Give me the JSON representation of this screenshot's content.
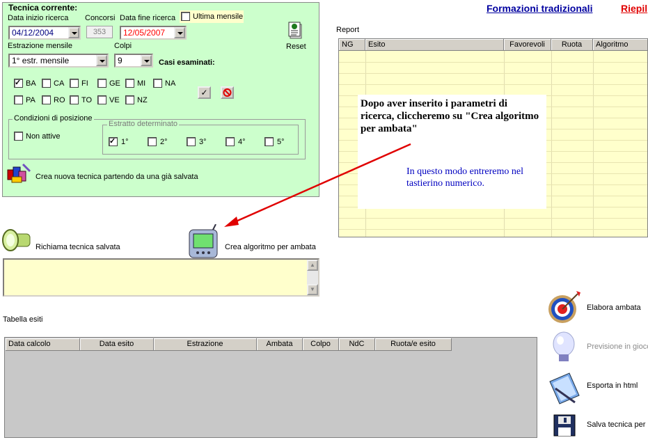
{
  "top_links": {
    "formazioni": "Formazioni tradizionali",
    "riepilogo": "Riepil"
  },
  "tecnica": {
    "title": "Tecnica corrente:",
    "data_inizio_label": "Data inizio ricerca",
    "data_inizio_value": "04/12/2004",
    "concorsi_label": "Concorsi",
    "concorsi_value": "353",
    "data_fine_label": "Data fine ricerca",
    "data_fine_value": "12/05/2007",
    "ultima_mensile_label": "Ultima mensile",
    "ultima_mensile_checked": false,
    "reset_label": "Reset",
    "estrazione_label": "Estrazione mensile",
    "estrazione_value": "1° estr. mensile",
    "colpi_label": "Colpi",
    "colpi_value": "9",
    "casi_label": "Casi esaminati:",
    "ruote": [
      {
        "label": "BA",
        "checked": true
      },
      {
        "label": "CA",
        "checked": false
      },
      {
        "label": "FI",
        "checked": false
      },
      {
        "label": "GE",
        "checked": false
      },
      {
        "label": "MI",
        "checked": false
      },
      {
        "label": "NA",
        "checked": false
      },
      {
        "label": "PA",
        "checked": false
      },
      {
        "label": "RO",
        "checked": false
      },
      {
        "label": "TO",
        "checked": false
      },
      {
        "label": "VE",
        "checked": false
      },
      {
        "label": "NZ",
        "checked": false
      }
    ],
    "condizioni_label": "Condizioni di posizione",
    "non_attive_label": "Non attive",
    "non_attive_checked": false,
    "estratto_label": "Estratto determinato",
    "estratti": [
      {
        "label": "1°",
        "checked": true
      },
      {
        "label": "2°",
        "checked": false
      },
      {
        "label": "3°",
        "checked": false
      },
      {
        "label": "4°",
        "checked": false
      },
      {
        "label": "5°",
        "checked": false
      }
    ],
    "crea_nuova_label": "Crea nuova tecnica partendo da una già salvata"
  },
  "report": {
    "label": "Report",
    "columns": [
      "NG",
      "Esito",
      "Favorevoli",
      "Ruota",
      "Algoritmo"
    ]
  },
  "callout": {
    "text": "Dopo aver inserito i parametri di ricerca, cliccheremo su \"Crea algoritmo per ambata\"",
    "subtext": "In questo modo entreremo nel tastierino numerico."
  },
  "actions": {
    "richiama": "Richiama tecnica salvata",
    "crea_algoritmo": "Crea algoritmo per ambata"
  },
  "tabella": {
    "label": "Tabella esiti",
    "columns": [
      "Data calcolo",
      "Data esito",
      "Estrazione",
      "Ambata",
      "Colpo",
      "NdC",
      "Ruota/e esito"
    ]
  },
  "side_actions": {
    "elabora": "Elabora ambata",
    "previsione": "Previsione in gioco",
    "esporta": "Esporta in html",
    "salva": "Salva tecnica per"
  },
  "colors": {
    "panel_green": "#ccffcc",
    "grid_yellow": "#ffffcc",
    "link_blue": "#0000a0",
    "link_red": "#e00000",
    "date_red": "#ff0000",
    "callout_blue": "#0000c0",
    "arrow_red": "#e00000"
  }
}
